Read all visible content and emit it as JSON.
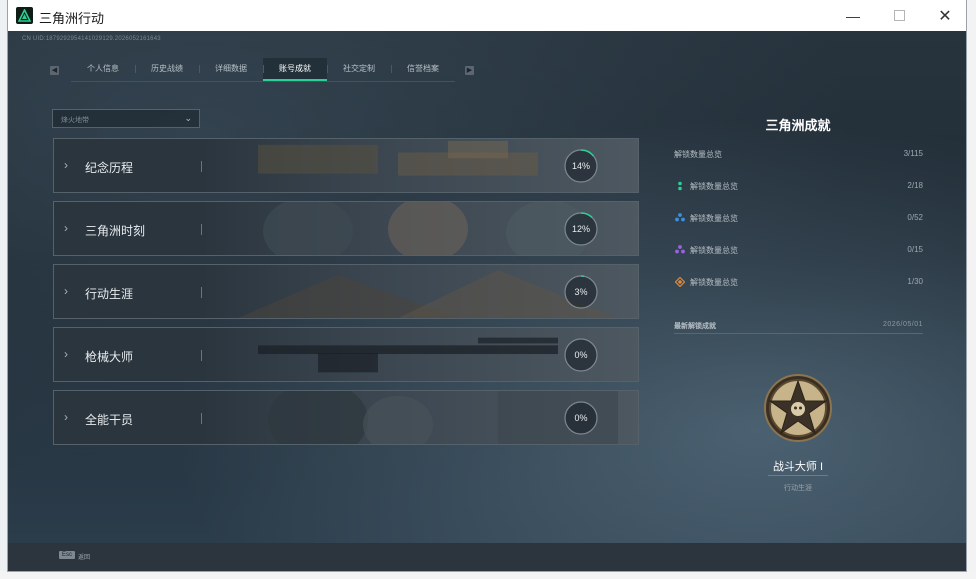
{
  "window": {
    "title": "三角洲行动"
  },
  "header": {
    "uid_text": "CN UID:1879292954141029129.2026052161643"
  },
  "tabs": [
    {
      "label": "个人信息",
      "active": false
    },
    {
      "label": "历史战绩",
      "active": false
    },
    {
      "label": "详细数据",
      "active": false
    },
    {
      "label": "账号成就",
      "active": true
    },
    {
      "label": "社交定制",
      "active": false
    },
    {
      "label": "信誉档案",
      "active": false
    }
  ],
  "filter": {
    "selected": "烽火地带"
  },
  "categories": [
    {
      "name": "纪念历程",
      "percent": 14,
      "percent_text": "14%"
    },
    {
      "name": "三角洲时刻",
      "percent": 12,
      "percent_text": "12%"
    },
    {
      "name": "行动生涯",
      "percent": 3,
      "percent_text": "3%"
    },
    {
      "name": "枪械大师",
      "percent": 0,
      "percent_text": "0%"
    },
    {
      "name": "全能干员",
      "percent": 0,
      "percent_text": "0%"
    }
  ],
  "summary": {
    "title": "三角洲成就",
    "total_label": "解锁数量总览",
    "total_value": "3/115",
    "tiers": [
      {
        "label": "解锁数量总览",
        "value": "2/18",
        "icon": "green-tier-icon",
        "color": "#2ad197"
      },
      {
        "label": "解锁数量总览",
        "value": "0/52",
        "icon": "blue-tier-icon",
        "color": "#3d8fe0"
      },
      {
        "label": "解锁数量总览",
        "value": "0/15",
        "icon": "purple-tier-icon",
        "color": "#9a63e0"
      },
      {
        "label": "解锁数量总览",
        "value": "1/30",
        "icon": "orange-tier-icon",
        "color": "#e08a3d"
      }
    ]
  },
  "latest": {
    "heading": "最新解锁成就",
    "date": "2026/05/01",
    "medal_name": "战斗大师 I",
    "medal_category": "行动生涯"
  },
  "footer": {
    "key": "Esc",
    "label": "返回"
  },
  "colors": {
    "accent": "#2ad197"
  }
}
